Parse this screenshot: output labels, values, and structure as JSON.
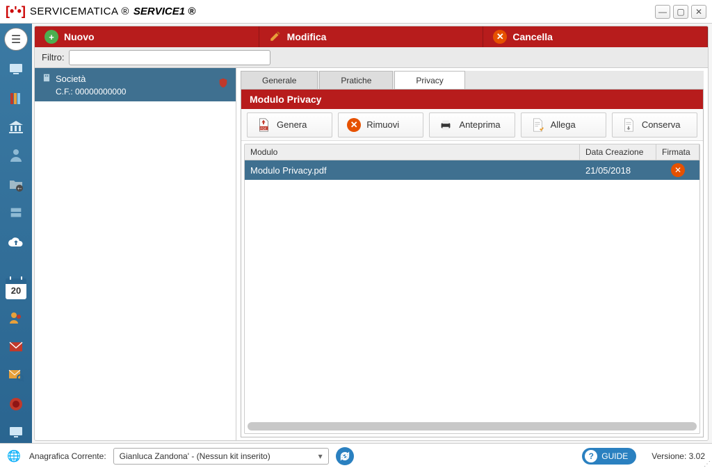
{
  "titlebar": {
    "brand1": "SERVICEMATICA ®",
    "brand2": "SERVICE1 ®"
  },
  "actions": {
    "nuovo": "Nuovo",
    "modifica": "Modifica",
    "cancella": "Cancella"
  },
  "filter": {
    "label": "Filtro:",
    "value": ""
  },
  "sidebar": {
    "calendar_number": "20"
  },
  "list": {
    "items": [
      {
        "title": "Società",
        "cf": "C.F.: 00000000000"
      }
    ]
  },
  "tabs": {
    "generale": "Generale",
    "pratiche": "Pratiche",
    "privacy": "Privacy"
  },
  "section": {
    "title": "Modulo Privacy"
  },
  "toolbar": {
    "genera": "Genera",
    "rimuovi": "Rimuovi",
    "anteprima": "Anteprima",
    "allega": "Allega",
    "conserva": "Conserva"
  },
  "table": {
    "headers": {
      "modulo": "Modulo",
      "data": "Data Creazione",
      "firmata": "Firmata"
    },
    "rows": [
      {
        "modulo": "Modulo Privacy.pdf",
        "data": "21/05/2018",
        "firmata": false
      }
    ]
  },
  "statusbar": {
    "label": "Anagrafica Corrente:",
    "combo": "Gianluca Zandona' -  (Nessun kit inserito)",
    "guide": "GUIDE",
    "version": "Versione: 3.02"
  }
}
